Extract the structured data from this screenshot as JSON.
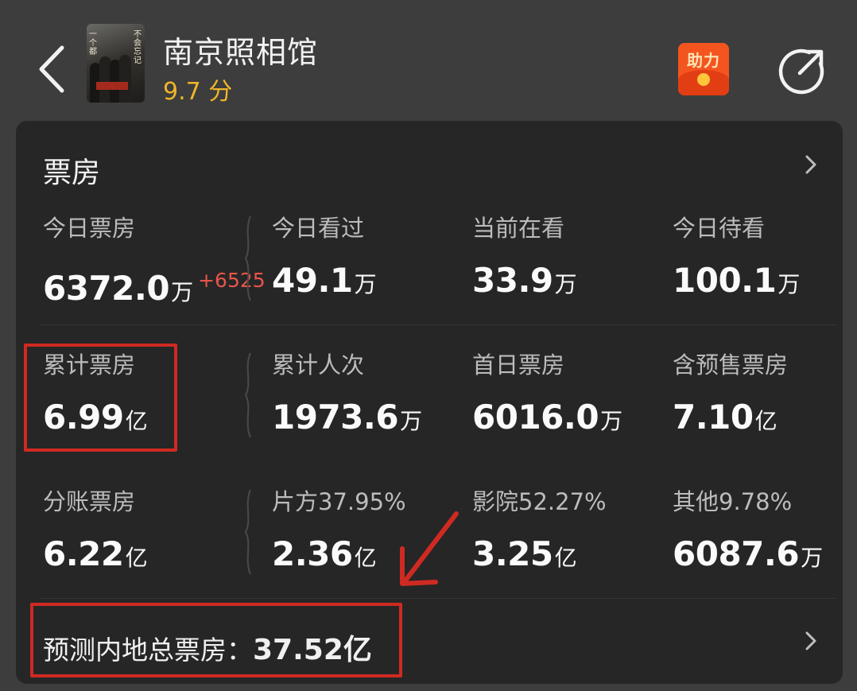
{
  "header": {
    "back_icon": "chevron-left-icon",
    "poster": {
      "caption_col_1": "一个都",
      "caption_col_2": "不会忘记",
      "banner_text": "南京照相馆"
    },
    "title": "南京照相馆",
    "score": "9.7 分",
    "help_badge_label": "助力",
    "share_icon": "share-circle-arrow-icon"
  },
  "box_office": {
    "title": "票房",
    "rows": [
      [
        {
          "label": "今日票房",
          "value": "6372.0",
          "unit": "万",
          "delta": "+6525"
        },
        {
          "label": "今日看过",
          "value": "49.1",
          "unit": "万"
        },
        {
          "label": "当前在看",
          "value": "33.9",
          "unit": "万"
        },
        {
          "label": "今日待看",
          "value": "100.1",
          "unit": "万"
        }
      ],
      [
        {
          "label": "累计票房",
          "value": "6.99",
          "unit": "亿"
        },
        {
          "label": "累计人次",
          "value": "1973.6",
          "unit": "万"
        },
        {
          "label": "首日票房",
          "value": "6016.0",
          "unit": "万"
        },
        {
          "label": "含预售票房",
          "value": "7.10",
          "unit": "亿"
        }
      ],
      [
        {
          "label": "分账票房",
          "value": "6.22",
          "unit": "亿"
        },
        {
          "label": "片方37.95%",
          "value": "2.36",
          "unit": "亿"
        },
        {
          "label": "影院52.27%",
          "value": "3.25",
          "unit": "亿"
        },
        {
          "label": "其他9.78%",
          "value": "6087.6",
          "unit": "万"
        }
      ]
    ],
    "prediction": {
      "label": "预测内地总票房：",
      "value": "37.52亿"
    }
  },
  "colors": {
    "background": "#3d3d3d",
    "card": "#262626",
    "score": "#f0b52a",
    "delta": "#e8554a",
    "annotation": "#cf2a22",
    "help_badge": "#f4551e"
  }
}
